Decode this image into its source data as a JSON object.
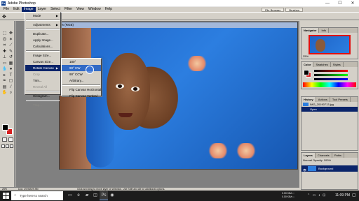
{
  "window": {
    "title": "Adobe Photoshop",
    "app_icon_text": "Ps",
    "minimize": "—",
    "maximize": "☐",
    "close": "✕"
  },
  "menubar": [
    "File",
    "Edit",
    "Image",
    "Layer",
    "Select",
    "Filter",
    "View",
    "Window",
    "Help"
  ],
  "menubar_active": "Image",
  "palette_tabs": [
    "File Browser",
    "Brushes"
  ],
  "document": {
    "title_fragment": "% (RGB)"
  },
  "image_menu": [
    {
      "label": "Mode",
      "submenu": true,
      "disabled": false
    },
    {
      "sep": true
    },
    {
      "label": "Adjustments",
      "submenu": true,
      "disabled": false
    },
    {
      "sep": true
    },
    {
      "label": "Duplicate...",
      "submenu": false,
      "disabled": false
    },
    {
      "label": "Apply Image...",
      "submenu": false,
      "disabled": false
    },
    {
      "label": "Calculations...",
      "submenu": false,
      "disabled": false
    },
    {
      "sep": true
    },
    {
      "label": "Image Size...",
      "submenu": false,
      "disabled": false
    },
    {
      "label": "Canvas Size...",
      "submenu": false,
      "disabled": false
    },
    {
      "label": "Rotate Canvas",
      "submenu": true,
      "disabled": false,
      "highlighted": true
    },
    {
      "label": "Crop",
      "submenu": false,
      "disabled": true
    },
    {
      "label": "Trim...",
      "submenu": false,
      "disabled": false
    },
    {
      "label": "Reveal All",
      "submenu": false,
      "disabled": true
    },
    {
      "sep": true
    },
    {
      "label": "Histogram...",
      "submenu": false,
      "disabled": false
    },
    {
      "sep": true
    },
    {
      "label": "Trap...",
      "submenu": false,
      "disabled": true
    }
  ],
  "rotate_menu": [
    {
      "label": "180°",
      "highlighted": false
    },
    {
      "label": "90° CW",
      "highlighted": true
    },
    {
      "label": "90° CCW",
      "highlighted": false
    },
    {
      "label": "Arbitrary...",
      "highlighted": false
    },
    {
      "sep": true
    },
    {
      "label": "Flip Canvas Horizontal",
      "highlighted": false
    },
    {
      "label": "Flip Canvas Vertical",
      "highlighted": false
    }
  ],
  "panels": {
    "navigator_tabs": [
      "Navigator",
      "Info"
    ],
    "color_tabs": [
      "Color",
      "Swatches",
      "Styles"
    ],
    "history_tabs": [
      "History",
      "Actions",
      "Tool Presets"
    ],
    "history_rows": [
      {
        "label": "IMG_20190713.jpg",
        "selected": false
      },
      {
        "label": "Open",
        "selected": true
      }
    ],
    "layers_tabs": [
      "Layers",
      "Channels",
      "Paths"
    ],
    "layers_opts": "Normal     Opacity: 100%",
    "layer_name": "Background",
    "nav_zoom": "25%"
  },
  "status": {
    "zoom": "25%",
    "doc": "Doc: 29.9M/29.9M",
    "hint": "Click and drag to move layer or selection. Use Shift and Alt for additional options."
  },
  "taskbar": {
    "search_placeholder": "Type here to search",
    "net_up": "0.00 KB/s ↑",
    "net_down": "0.00 KB/s ↓",
    "time": "11:09 PM"
  },
  "colors": {
    "foreground": "#000000",
    "background": "#d71f1f",
    "menu_highlight": "#0a246a"
  }
}
